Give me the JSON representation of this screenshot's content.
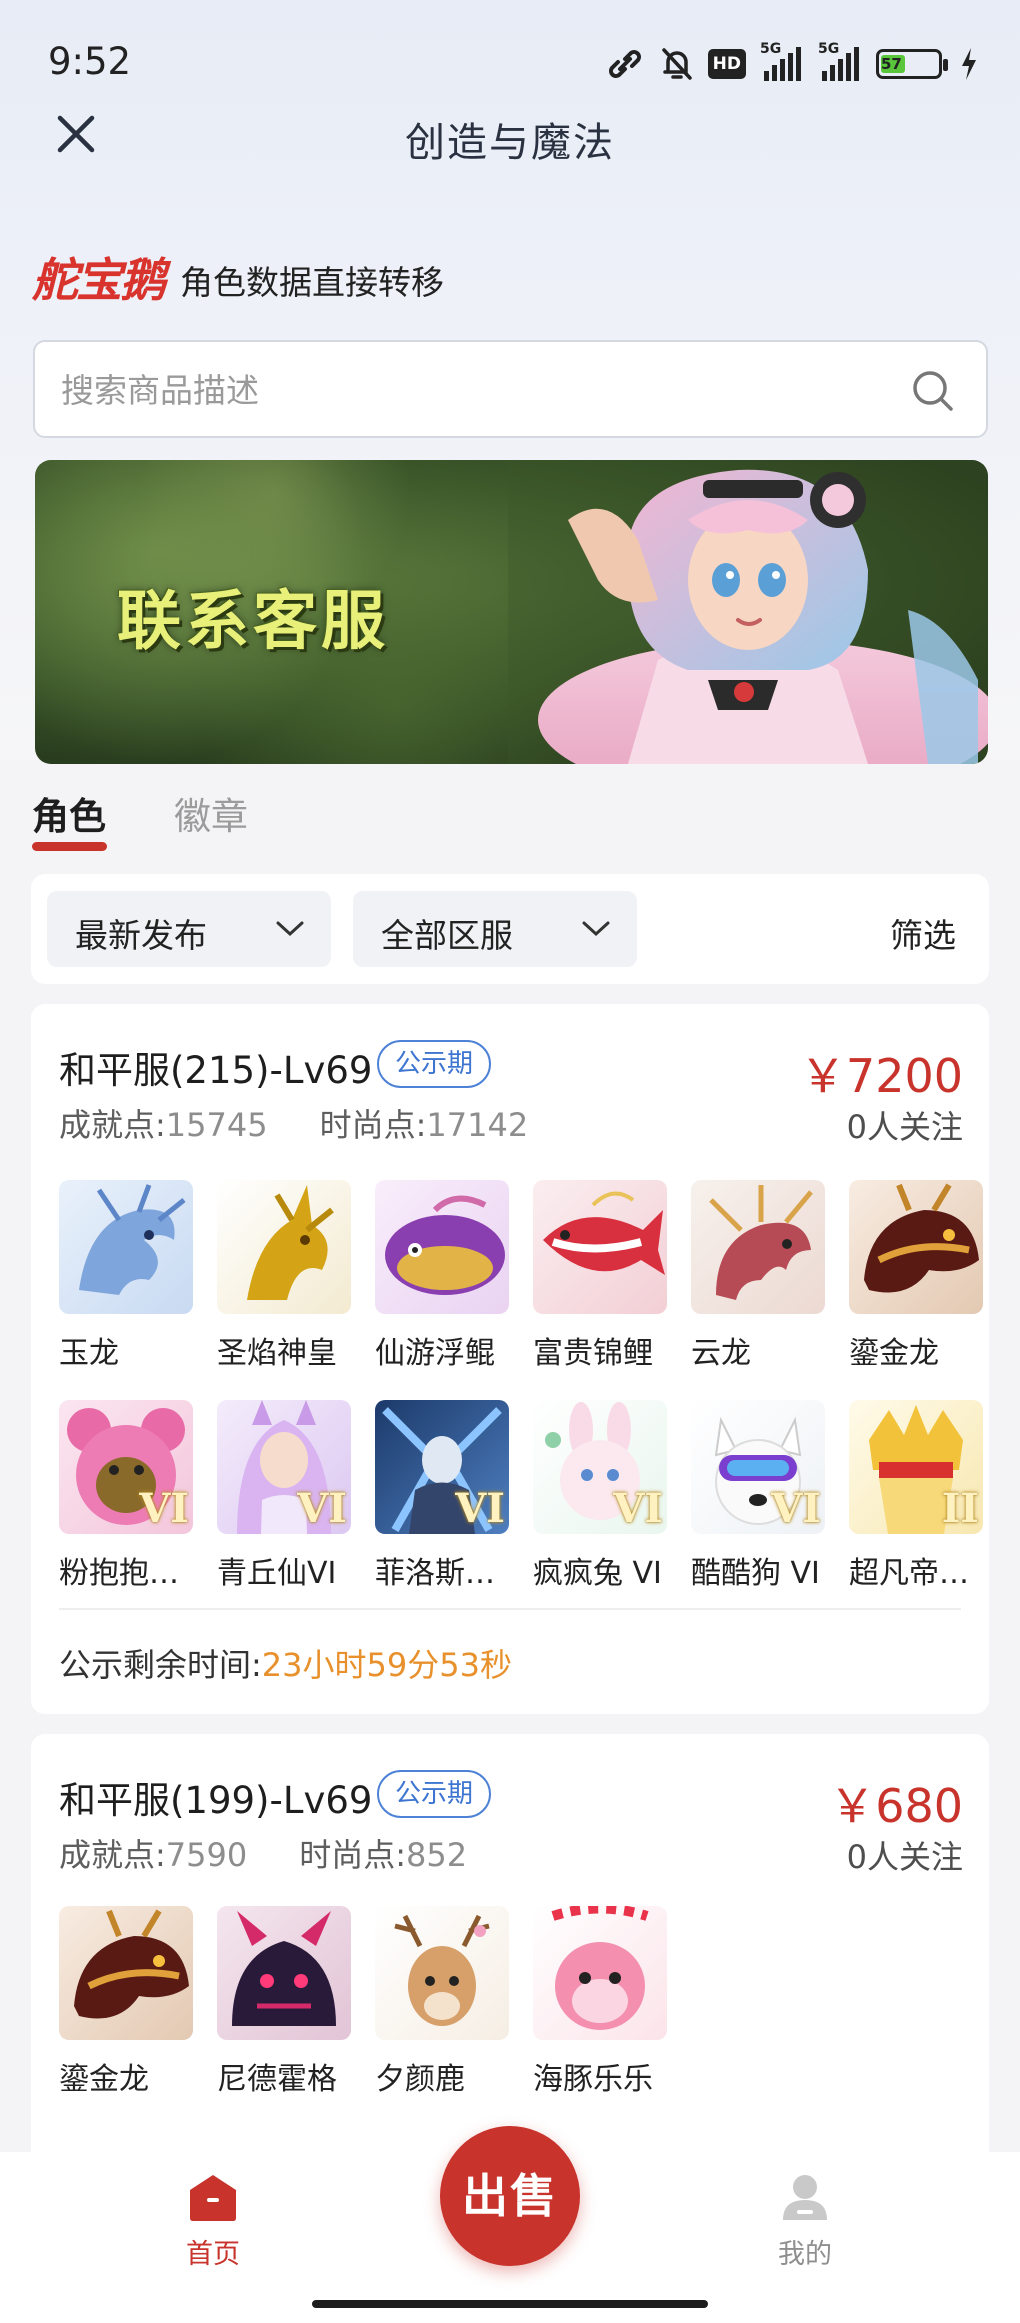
{
  "status_bar": {
    "time": "9:52",
    "hd_label": "HD",
    "network_1": "5G",
    "network_2": "5G",
    "battery_level": "57",
    "battery_percent": 57,
    "icons": [
      "link-icon",
      "bell-muted-icon",
      "hd-icon",
      "signal-icon",
      "signal-icon",
      "battery-icon",
      "charging-icon"
    ]
  },
  "nav": {
    "title": "创造与魔法",
    "close_icon": "close-icon"
  },
  "brand": {
    "logo_text": "舵宝鹅",
    "tagline": "角色数据直接转移"
  },
  "search": {
    "placeholder": "搜索商品描述",
    "value": ""
  },
  "banner": {
    "text": "联系客服"
  },
  "tabs": [
    {
      "label": "角色",
      "active": true
    },
    {
      "label": "徽章",
      "active": false
    }
  ],
  "filters": {
    "sort": "最新发布",
    "server": "全部区服",
    "filter_label": "筛选"
  },
  "listings": [
    {
      "title": "和平服(215)-Lv69",
      "tag": "公示期",
      "price": "￥7200",
      "achievement_label": "成就点:",
      "achievement_value": "15745",
      "fashion_label": "时尚点:",
      "fashion_value": "17142",
      "followers": "0人关注",
      "items_row1": [
        {
          "name": "玉龙",
          "rank": ""
        },
        {
          "name": "圣焰神皇",
          "rank": ""
        },
        {
          "name": "仙游浮鲲",
          "rank": ""
        },
        {
          "name": "富贵锦鲤",
          "rank": ""
        },
        {
          "name": "云龙",
          "rank": ""
        },
        {
          "name": "鎏金龙",
          "rank": ""
        }
      ],
      "items_row2": [
        {
          "name": "粉抱抱…",
          "rank": "VI"
        },
        {
          "name": "青丘仙VI",
          "rank": "VI"
        },
        {
          "name": "菲洛斯…",
          "rank": "VI"
        },
        {
          "name": "疯疯兔 VI",
          "rank": "VI"
        },
        {
          "name": "酷酷狗 VI",
          "rank": "VI"
        },
        {
          "name": "超凡帝…",
          "rank": "II"
        }
      ],
      "countdown_label": "公示剩余时间:",
      "countdown_value": "23小时59分53秒"
    },
    {
      "title": "和平服(199)-Lv69",
      "tag": "公示期",
      "price": "￥680",
      "achievement_label": "成就点:",
      "achievement_value": "7590",
      "fashion_label": "时尚点:",
      "fashion_value": "852",
      "followers": "0人关注",
      "items_row1": [
        {
          "name": "鎏金龙",
          "rank": ""
        },
        {
          "name": "尼德霍格",
          "rank": ""
        },
        {
          "name": "夕颜鹿",
          "rank": ""
        },
        {
          "name": "海豚乐乐",
          "rank": ""
        }
      ]
    }
  ],
  "bottom_nav": {
    "home_label": "首页",
    "sell_label": "出售",
    "mine_label": "我的"
  },
  "colors": {
    "accent_red": "#c8332c",
    "tag_blue": "#3d75d0",
    "countdown_orange": "#e8912c"
  }
}
